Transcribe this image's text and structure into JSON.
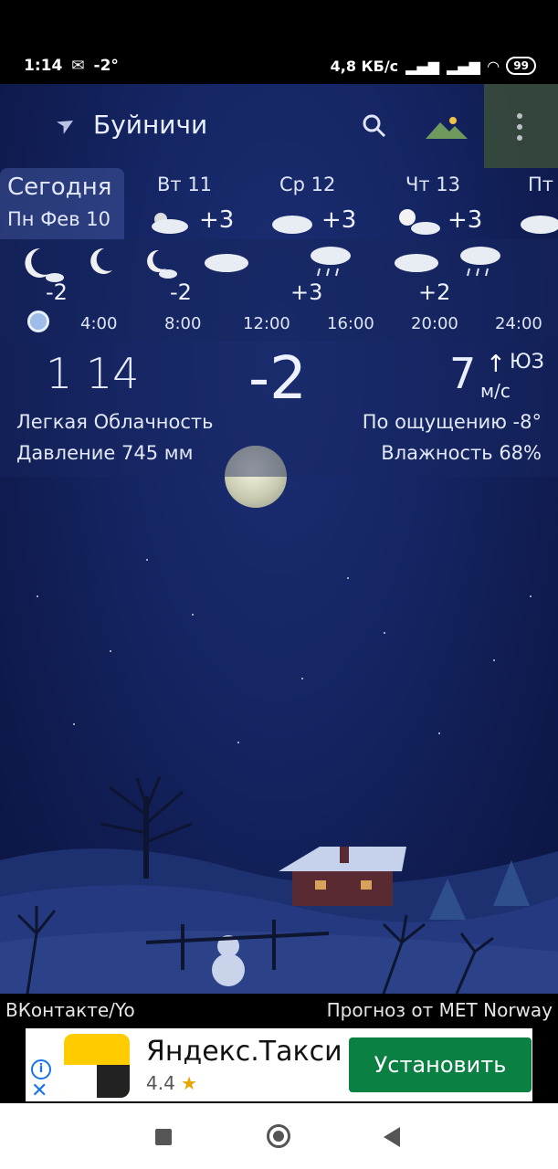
{
  "status": {
    "time": "1:14",
    "temp": "-2°",
    "net_speed": "4,8 КБ/с",
    "battery": "99"
  },
  "toolbar": {
    "location": "Буйничи"
  },
  "days": [
    {
      "name": "Сегодня",
      "date": "Пн Фев 10"
    },
    {
      "name": "Вт 11",
      "temp": "+3"
    },
    {
      "name": "Ср 12",
      "temp": "+3"
    },
    {
      "name": "Чт 13",
      "temp": "+3"
    },
    {
      "name": "Пт"
    }
  ],
  "hourly": {
    "times": [
      "4:00",
      "8:00",
      "12:00",
      "16:00",
      "20:00",
      "24:00"
    ],
    "temps": [
      "-2",
      "-2",
      "+3",
      "+2"
    ]
  },
  "current": {
    "time": "1 14",
    "temp": "-2",
    "wind_speed": "7",
    "wind_dir": "ЮЗ",
    "wind_unit": "м/с",
    "condition": "Легкая Облачность",
    "feels_like": "По ощущению -8°",
    "pressure": "Давление 745 мм",
    "humidity": "Влажность 68%"
  },
  "footer": {
    "left": "ВКонтакте/Yo",
    "right": "Прогноз от MET Norway"
  },
  "ad": {
    "app_name": "Яндекс.Такси",
    "rating": "4.4",
    "install_label": "Установить"
  },
  "colors": {
    "sky": "#152563",
    "menu_bg": "#3b4e39",
    "install_bg": "#0b8043"
  }
}
